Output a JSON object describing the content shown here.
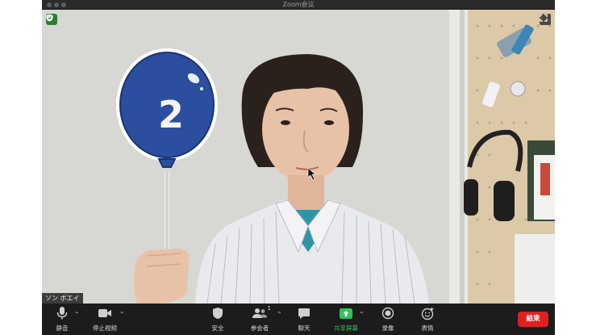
{
  "window": {
    "title": "Zoom会议"
  },
  "video": {
    "participant_name": "ソン ボエイ",
    "sign_number": "2",
    "balloon_color": "#2b4f9e"
  },
  "toolbar": {
    "mute_label": "静音",
    "stop_video_label": "停止视频",
    "security_label": "安全",
    "participants_label": "参会者",
    "participants_count": "1",
    "chat_label": "聊天",
    "share_screen_label": "共享屏幕",
    "record_label": "录像",
    "reactions_label": "表情",
    "end_label": "結束"
  },
  "colors": {
    "share_green": "#33c15a",
    "end_red": "#e02020",
    "security_badge_green": "#2f7d32"
  }
}
